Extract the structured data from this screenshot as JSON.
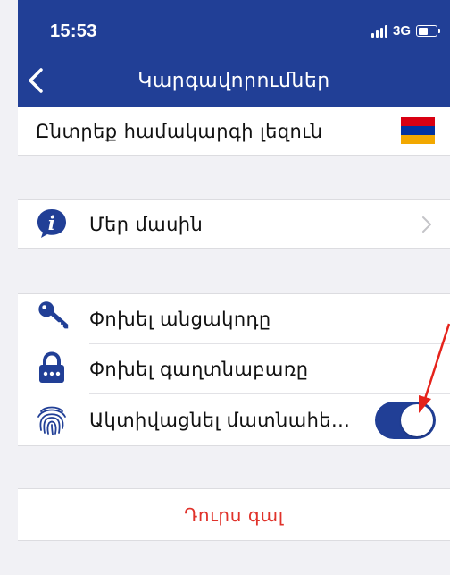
{
  "status_bar": {
    "time": "15:53",
    "network": "3G"
  },
  "header": {
    "title": "Կարգավորումներ",
    "back_icon": "chevron-left-icon"
  },
  "language_row": {
    "label": "Ընտրեք համակարգի լեզուն",
    "flag_colors": [
      "#d90012",
      "#0033a0",
      "#f2a800"
    ]
  },
  "about_row": {
    "label": "Մեր մասին",
    "icon": "info-icon"
  },
  "security": {
    "change_pin_label": "Փոխել անցակոդը",
    "change_password_label": "Փոխել գաղտնաբառը",
    "fingerprint_label": "Ակտիվացնել մատնահե...",
    "fingerprint_enabled": true
  },
  "logout": {
    "label": "Դուրս գալ"
  },
  "colors": {
    "brand_blue": "#213f96",
    "logout_red": "#e0322a",
    "annotation_arrow": "#e5231b"
  }
}
